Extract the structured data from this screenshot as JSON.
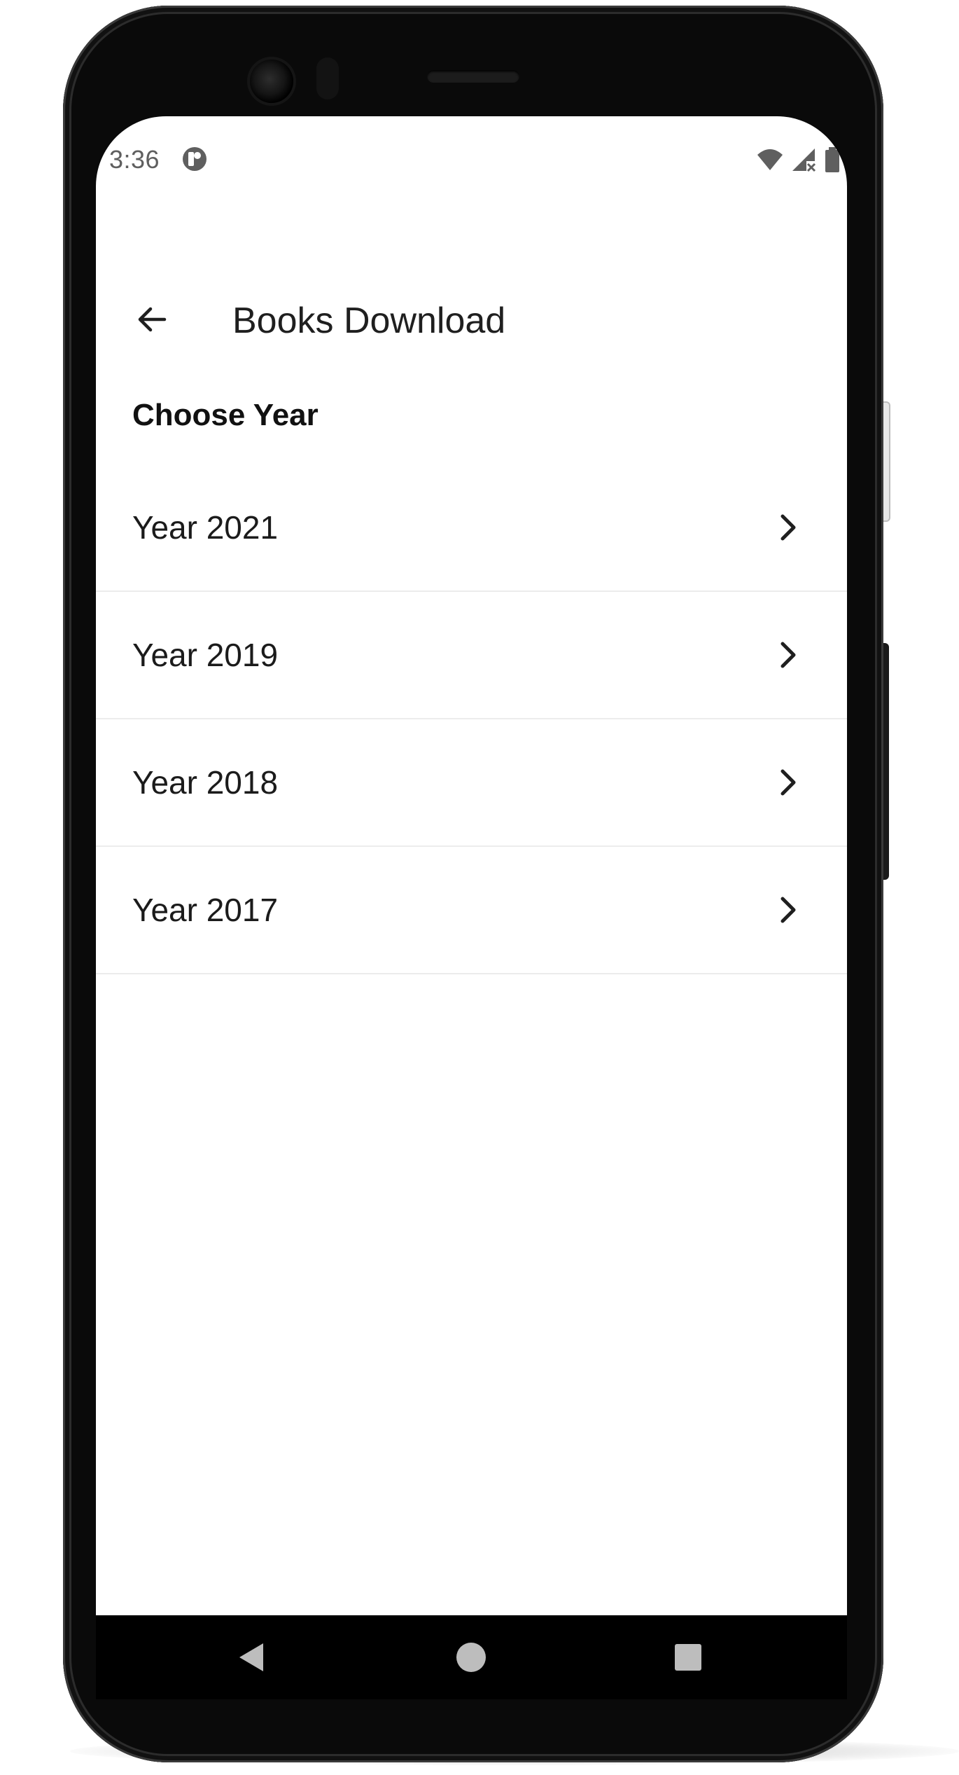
{
  "status_bar": {
    "time": "3:36",
    "app_icon": "app-notification-icon",
    "icons": [
      "wifi-icon",
      "cellular-no-signal-icon",
      "battery-icon"
    ]
  },
  "app_bar": {
    "back_icon": "arrow-back-icon",
    "title": "Books Download"
  },
  "section": {
    "header": "Choose Year"
  },
  "years": [
    {
      "label": "Year 2021",
      "icon": "chevron-right-icon"
    },
    {
      "label": "Year 2019",
      "icon": "chevron-right-icon"
    },
    {
      "label": "Year 2018",
      "icon": "chevron-right-icon"
    },
    {
      "label": "Year 2017",
      "icon": "chevron-right-icon"
    }
  ],
  "nav_bar": {
    "buttons": [
      "back-triangle-icon",
      "home-circle-icon",
      "recents-square-icon"
    ]
  },
  "colors": {
    "text_primary": "#1f1f1f",
    "status_text": "#5f5f5f",
    "divider": "#ececec",
    "frame": "#0a0a0a"
  }
}
